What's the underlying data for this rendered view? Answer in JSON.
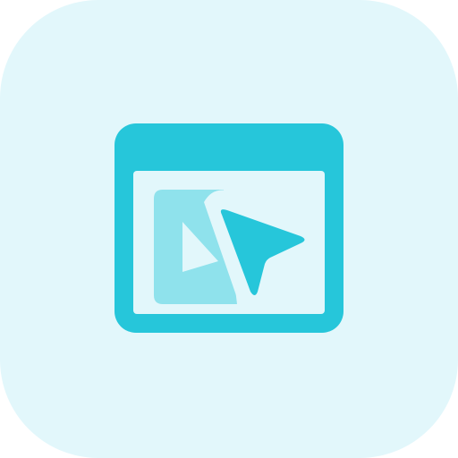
{
  "icon": {
    "name": "browser-cursor-click-icon",
    "colors": {
      "background": "#E2F7FB",
      "frame": "#26C6DA",
      "panel": "#8FE2EC",
      "inner": "#E2F7FB",
      "cursor": "#26C6DA"
    }
  }
}
